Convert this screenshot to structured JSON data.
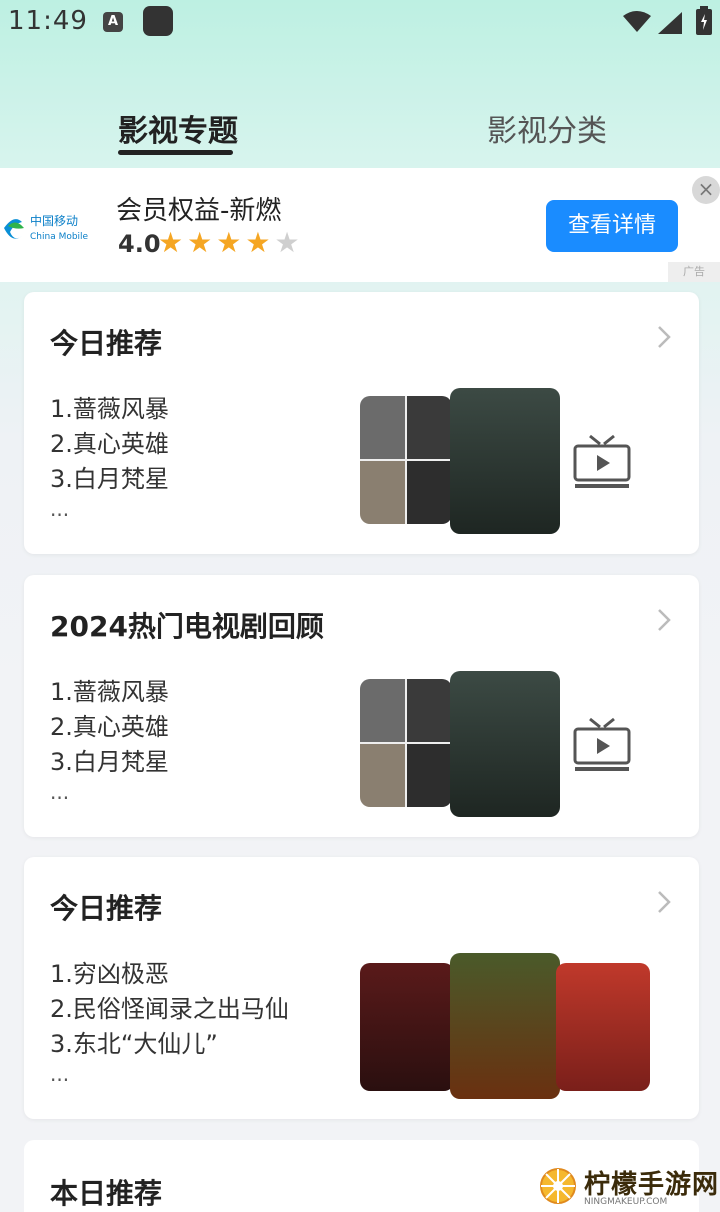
{
  "status_bar": {
    "time": "11:49",
    "app_badge": "A"
  },
  "tabs": [
    {
      "label": "影视专题",
      "active": true
    },
    {
      "label": "影视分类",
      "active": false
    }
  ],
  "ad": {
    "brand_line1": "中国移动",
    "brand_line2": "China Mobile",
    "title": "会员权益-新燃",
    "rating": "4.0",
    "stars_filled": 4,
    "stars_total": 5,
    "cta": "查看详情",
    "close": "×",
    "mark": "广告"
  },
  "cards": [
    {
      "title": "今日推荐",
      "items": [
        "1.蔷薇风暴",
        "2.真心英雄",
        "3.白月梵星"
      ],
      "more": "..."
    },
    {
      "title": "2024热门电视剧回顾",
      "items": [
        "1.蔷薇风暴",
        "2.真心英雄",
        "3.白月梵星"
      ],
      "more": "..."
    },
    {
      "title": "今日推荐",
      "items": [
        "1.穷凶极恶",
        "2.民俗怪闻录之出马仙",
        "3.东北“大仙儿”"
      ],
      "more": "..."
    },
    {
      "title": "本日推荐"
    }
  ],
  "watermark": {
    "text": "柠檬手游网",
    "sub": "NINGMAKEUP.COM"
  },
  "colors": {
    "accent": "#1a8cff",
    "star": "#f5a623",
    "brand_green": "#bdf0e2"
  }
}
